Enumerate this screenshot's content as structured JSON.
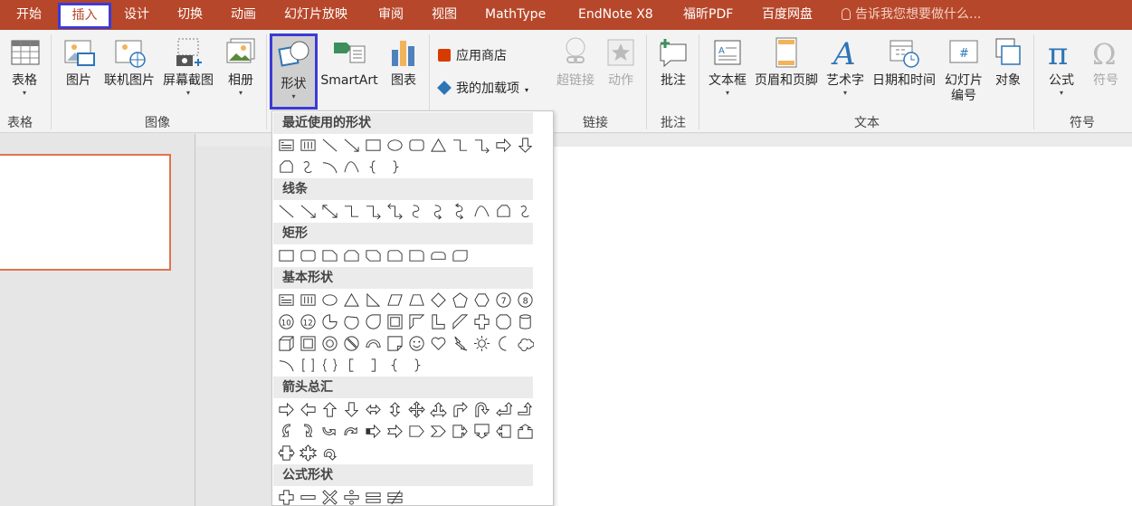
{
  "tabs": [
    "开始",
    "插入",
    "设计",
    "切换",
    "动画",
    "幻灯片放映",
    "审阅",
    "视图",
    "MathType",
    "EndNote X8",
    "福昕PDF",
    "百度网盘"
  ],
  "tell_me": "告诉我您想要做什么...",
  "ribbon": {
    "table": {
      "label": "表格",
      "group": "表格"
    },
    "images": {
      "picture": "图片",
      "online_picture": "联机图片",
      "screenshot": "屏幕截图",
      "album": "相册",
      "group": "图像"
    },
    "shapes": "形状",
    "smartart": "SmartArt",
    "chart": "图表",
    "store": "应用商店",
    "my_addins": "我的加载项",
    "links": {
      "hyperlink": "超链接",
      "action": "动作",
      "group": "链接"
    },
    "comments": {
      "comment": "批注",
      "group": "批注"
    },
    "text": {
      "textbox": "文本框",
      "header_footer": "页眉和页脚",
      "wordart": "艺术字",
      "datetime": "日期和时间",
      "slide_number_1": "幻灯片",
      "slide_number_2": "编号",
      "object": "对象",
      "group": "文本"
    },
    "symbols": {
      "equation": "公式",
      "symbol": "符号",
      "group": "符号"
    }
  },
  "shape_sections": {
    "recent": "最近使用的形状",
    "lines": "线条",
    "rect": "矩形",
    "basic": "基本形状",
    "arrows": "箭头总汇",
    "equation": "公式形状"
  },
  "colors": {
    "accent": "#b7472a",
    "highlight": "#3b3bd6"
  }
}
